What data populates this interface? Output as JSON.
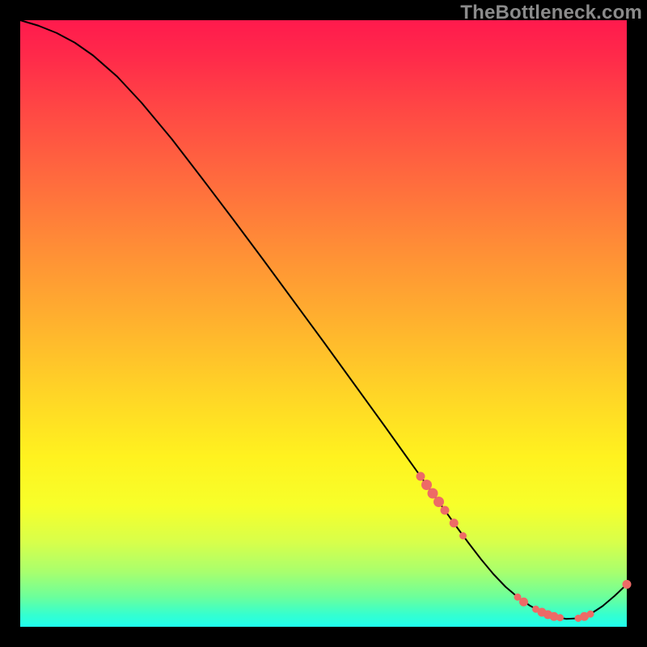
{
  "watermark": "TheBottleneck.com",
  "colors": {
    "curve": "#000000",
    "marker": "#ed6a66",
    "gradient_top": "#ff1a4d",
    "gradient_bottom": "#1fffee"
  },
  "chart_data": {
    "type": "line",
    "title": "",
    "xlabel": "",
    "ylabel": "",
    "xlim": [
      0,
      100
    ],
    "ylim": [
      0,
      100
    ],
    "grid": false,
    "legend": false,
    "x": [
      0,
      3,
      6,
      9,
      12,
      16,
      20,
      25,
      30,
      35,
      40,
      45,
      50,
      55,
      60,
      64,
      68,
      70,
      72,
      74,
      76,
      78,
      80,
      82,
      84,
      86,
      88,
      90,
      92,
      94,
      96,
      98,
      100
    ],
    "y": [
      100,
      99.1,
      97.9,
      96.3,
      94.2,
      90.7,
      86.4,
      80.4,
      73.9,
      67.3,
      60.6,
      53.8,
      47.0,
      40.1,
      33.2,
      27.6,
      22.0,
      19.2,
      16.4,
      13.7,
      11.1,
      8.7,
      6.6,
      4.9,
      3.5,
      2.4,
      1.7,
      1.3,
      1.4,
      2.1,
      3.4,
      5.1,
      7.0
    ],
    "markers": [
      {
        "x": 66,
        "y": 24.8,
        "r": 5
      },
      {
        "x": 67,
        "y": 23.4,
        "r": 6
      },
      {
        "x": 68,
        "y": 22.0,
        "r": 6
      },
      {
        "x": 69,
        "y": 20.6,
        "r": 6
      },
      {
        "x": 70,
        "y": 19.2,
        "r": 5
      },
      {
        "x": 71.5,
        "y": 17.1,
        "r": 5
      },
      {
        "x": 73,
        "y": 15.0,
        "r": 4
      },
      {
        "x": 82,
        "y": 4.9,
        "r": 4
      },
      {
        "x": 83,
        "y": 4.1,
        "r": 5
      },
      {
        "x": 85,
        "y": 2.9,
        "r": 4
      },
      {
        "x": 86,
        "y": 2.4,
        "r": 5
      },
      {
        "x": 87,
        "y": 2.0,
        "r": 5
      },
      {
        "x": 88,
        "y": 1.7,
        "r": 5
      },
      {
        "x": 89,
        "y": 1.5,
        "r": 4
      },
      {
        "x": 92,
        "y": 1.4,
        "r": 4
      },
      {
        "x": 93,
        "y": 1.7,
        "r": 5
      },
      {
        "x": 94,
        "y": 2.1,
        "r": 4
      },
      {
        "x": 100,
        "y": 7.0,
        "r": 5
      }
    ]
  }
}
